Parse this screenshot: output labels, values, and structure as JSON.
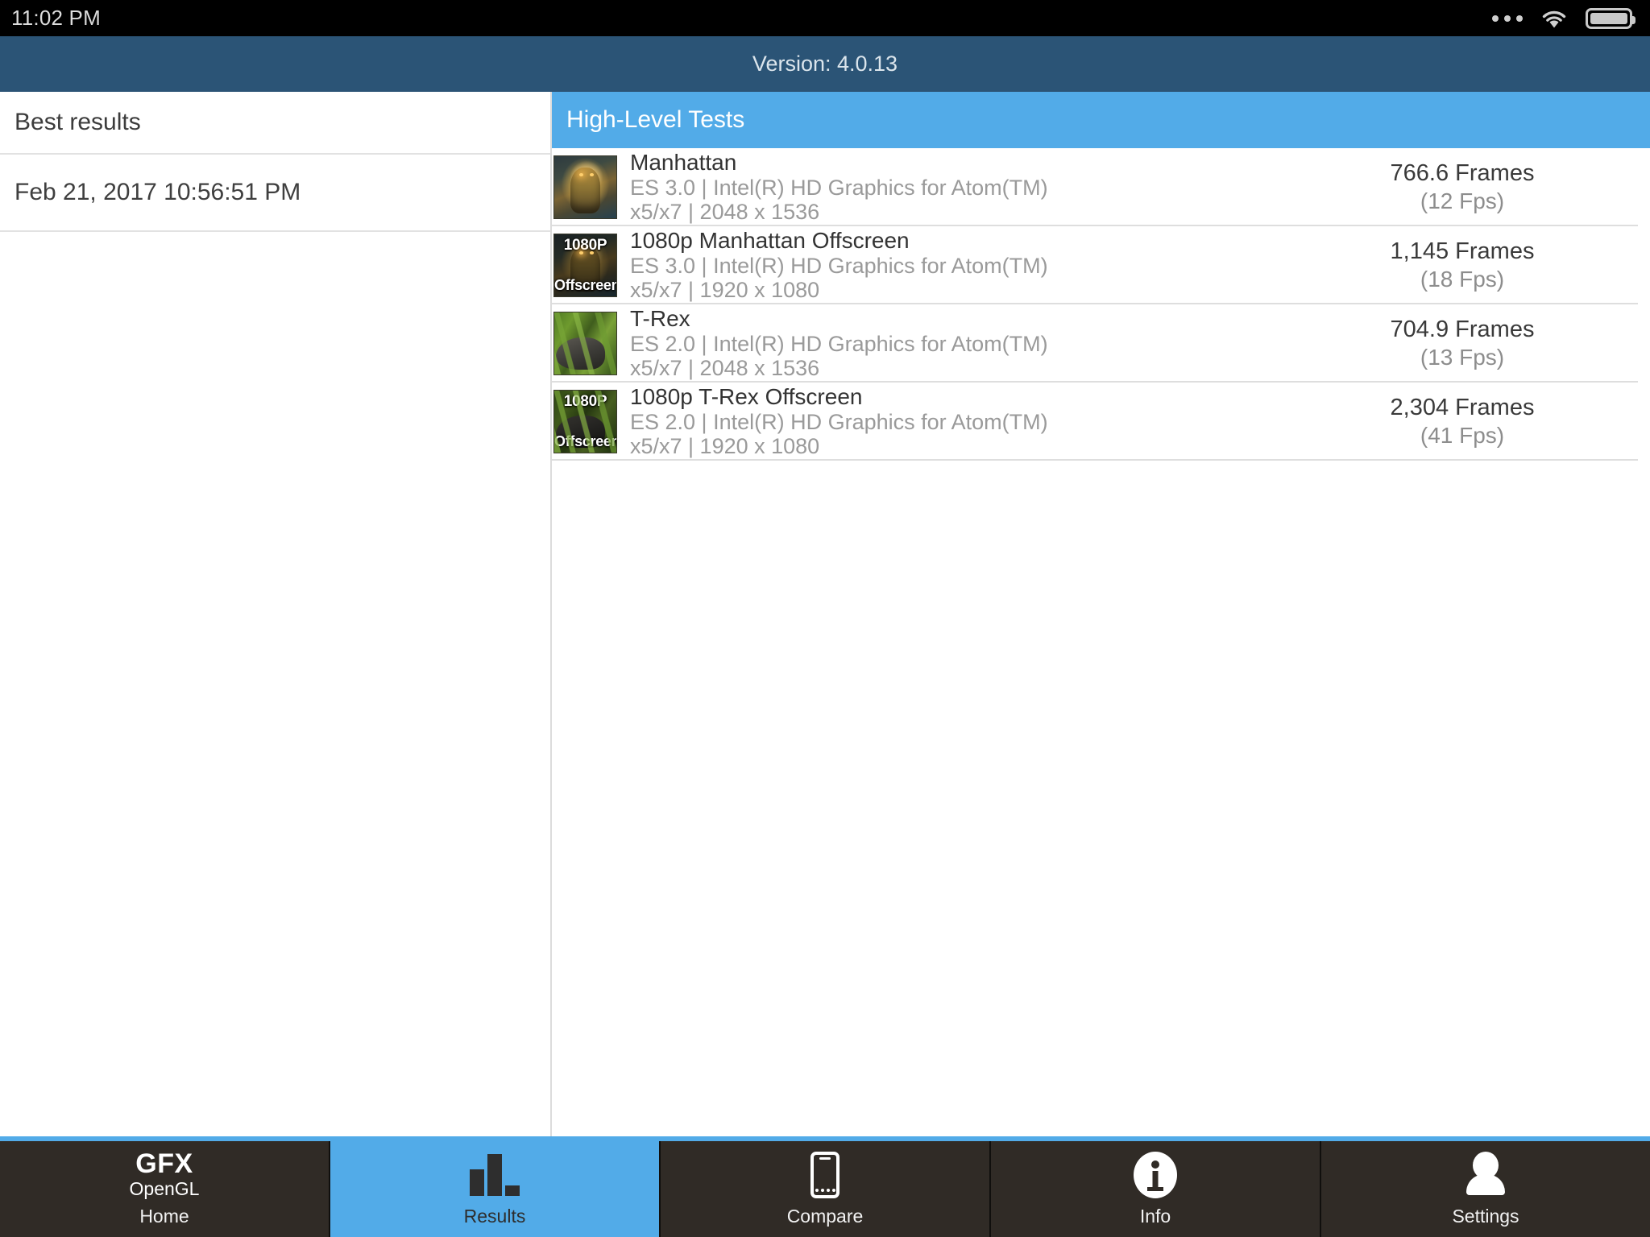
{
  "status_bar": {
    "time": "11:02 PM",
    "icons": [
      "more-dots-icon",
      "wifi-icon",
      "battery-icon"
    ]
  },
  "header": {
    "version_text": "Version: 4.0.13",
    "bg_color": "#2b5476"
  },
  "sidebar": {
    "title": "Best results",
    "items": [
      {
        "label": "Feb 21, 2017 10:56:51 PM"
      }
    ]
  },
  "content": {
    "section_title": "High-Level Tests",
    "section_color": "#52abe8",
    "rows": [
      {
        "name": "Manhattan",
        "api_device": "ES 3.0 | Intel(R) HD Graphics for Atom(TM)",
        "series_resolution": "x5/x7 | 2048 x 1536",
        "frames": "766.6 Frames",
        "fps": "(12 Fps)",
        "thumb": "manhattan",
        "offscreen": false,
        "badge_top": "",
        "badge_bottom": ""
      },
      {
        "name": "1080p Manhattan Offscreen",
        "api_device": "ES 3.0 | Intel(R) HD Graphics for Atom(TM)",
        "series_resolution": "x5/x7 | 1920 x 1080",
        "frames": "1,145 Frames",
        "fps": "(18 Fps)",
        "thumb": "manhattan",
        "offscreen": true,
        "badge_top": "1080P",
        "badge_bottom": "Offscreen"
      },
      {
        "name": "T-Rex",
        "api_device": "ES 2.0 | Intel(R) HD Graphics for Atom(TM)",
        "series_resolution": "x5/x7 | 2048 x 1536",
        "frames": "704.9 Frames",
        "fps": "(13 Fps)",
        "thumb": "trex",
        "offscreen": false,
        "badge_top": "",
        "badge_bottom": ""
      },
      {
        "name": "1080p T-Rex Offscreen",
        "api_device": "ES 2.0 | Intel(R) HD Graphics for Atom(TM)",
        "series_resolution": "x5/x7 | 1920 x 1080",
        "frames": "2,304 Frames",
        "fps": "(41 Fps)",
        "thumb": "trex",
        "offscreen": true,
        "badge_top": "1080P",
        "badge_bottom": "Offscreen"
      }
    ]
  },
  "bottom_nav": {
    "active": "Results",
    "items": [
      {
        "label": "Home",
        "icon": "gfx-opengl-logo",
        "logo_line1": "GFX",
        "logo_line2": "OpenGL",
        "active": false
      },
      {
        "label": "Results",
        "icon": "bar-chart-icon",
        "active": true
      },
      {
        "label": "Compare",
        "icon": "phone-icon",
        "active": false
      },
      {
        "label": "Info",
        "icon": "info-icon",
        "active": false
      },
      {
        "label": "Settings",
        "icon": "user-icon",
        "active": false
      }
    ]
  }
}
